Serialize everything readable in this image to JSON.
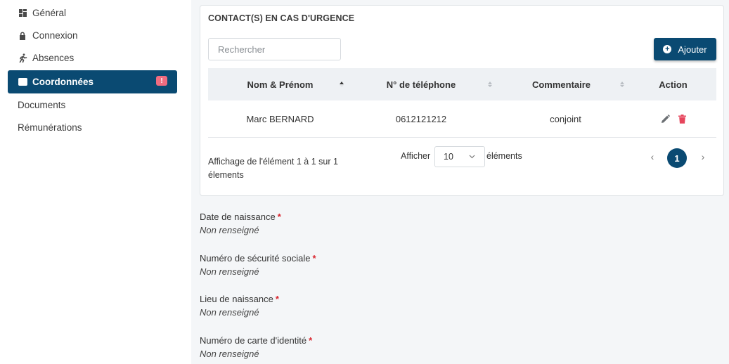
{
  "sidebar": {
    "items": [
      {
        "label": "Général",
        "icon": "dashboard-icon"
      },
      {
        "label": "Connexion",
        "icon": "lock-icon"
      },
      {
        "label": "Absences",
        "icon": "running-person-icon"
      },
      {
        "label": "Coordonnées",
        "icon": "id-card-icon",
        "active": true,
        "badge": "!"
      },
      {
        "label": "Documents"
      },
      {
        "label": "Rémunérations"
      }
    ]
  },
  "contacts": {
    "title": "CONTACT(S) EN CAS D'URGENCE",
    "search_placeholder": "Rechercher",
    "add_label": "Ajouter",
    "columns": [
      "Nom & Prénom",
      "N° de téléphone",
      "Commentaire",
      "Action"
    ],
    "rows": [
      {
        "name": "Marc BERNARD",
        "phone": "0612121212",
        "comment": "conjoint"
      }
    ],
    "info": "Affichage de l'élément 1 à 1 sur 1 élements",
    "show_label": "Afficher",
    "page_size": "10",
    "elements_label": "éléments",
    "pagination": {
      "prev": "‹",
      "current": "1",
      "next": "›"
    }
  },
  "fields": [
    {
      "label": "Date de naissance",
      "required": "*",
      "value": "Non renseigné"
    },
    {
      "label": "Numéro de sécurité sociale",
      "required": "*",
      "value": "Non renseigné"
    },
    {
      "label": "Lieu de naissance",
      "required": "*",
      "value": "Non renseigné"
    },
    {
      "label": "Numéro de carte d'identité",
      "required": "*",
      "value": "Non renseigné"
    }
  ],
  "colors": {
    "primary": "#0a4a72",
    "badge": "#f06c80",
    "delete": "#e6455c",
    "required": "#d9262f"
  }
}
